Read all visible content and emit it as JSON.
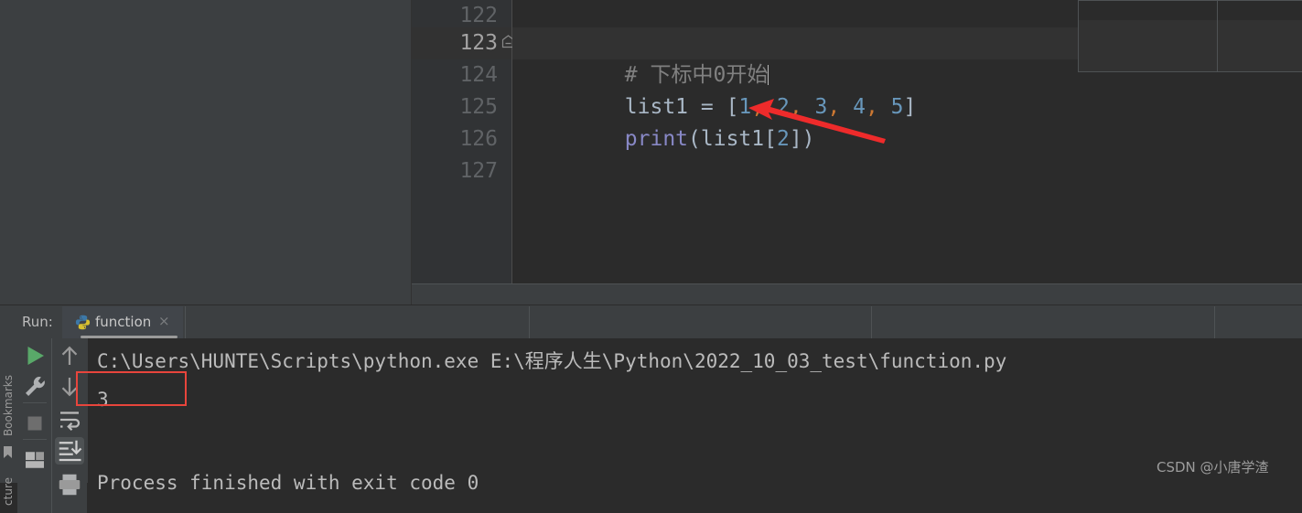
{
  "editor": {
    "lines": [
      {
        "number": "122",
        "current": false,
        "tokens": []
      },
      {
        "number": "123",
        "current": true,
        "tokens": [
          {
            "text": "# 下标中0开始",
            "type": "comment"
          }
        ]
      },
      {
        "number": "124",
        "current": false,
        "tokens": [
          {
            "text": "list1 ",
            "type": "ident"
          },
          {
            "text": "= ",
            "type": "punct"
          },
          {
            "text": "[",
            "type": "punct"
          },
          {
            "text": "1",
            "type": "num"
          },
          {
            "text": ", ",
            "type": "comma"
          },
          {
            "text": "2",
            "type": "num"
          },
          {
            "text": ", ",
            "type": "comma"
          },
          {
            "text": "3",
            "type": "num"
          },
          {
            "text": ", ",
            "type": "comma"
          },
          {
            "text": "4",
            "type": "num"
          },
          {
            "text": ", ",
            "type": "comma"
          },
          {
            "text": "5",
            "type": "num"
          },
          {
            "text": "]",
            "type": "punct"
          }
        ]
      },
      {
        "number": "125",
        "current": false,
        "tokens": [
          {
            "text": "print",
            "type": "func"
          },
          {
            "text": "(list1[",
            "type": "punct"
          },
          {
            "text": "2",
            "type": "num"
          },
          {
            "text": "])",
            "type": "punct"
          }
        ]
      },
      {
        "number": "126",
        "current": false,
        "tokens": []
      },
      {
        "number": "127",
        "current": false,
        "tokens": []
      }
    ],
    "line_texts": {
      "l122": "",
      "l123": "# 下标中0开始",
      "l124": "list1 = [1, 2, 3, 4, 5]",
      "l125": "print(list1[2])",
      "l126": "",
      "l127": ""
    },
    "line_numbers": {
      "n122": "122",
      "n123": "123",
      "n124": "124",
      "n125": "125",
      "n126": "126",
      "n127": "127"
    },
    "fold_marker": "code-fold-minus"
  },
  "run_panel": {
    "label": "Run:",
    "tab": {
      "icon": "python-icon",
      "title": "function",
      "close": "×"
    },
    "toolbar": {
      "rerun": "run-icon",
      "settings": "wrench-icon",
      "stop": "stop-icon",
      "layout": "layout-icon",
      "up": "arrow-up-icon",
      "down": "arrow-down-icon",
      "soft_wrap": "soft-wrap-icon",
      "scroll_to_end": "scroll-to-end-icon",
      "print": "print-icon"
    }
  },
  "sidebar": {
    "bookmarks_label": "Bookmarks",
    "structure_label": "cture",
    "bookmark_icon": "bookmark-icon"
  },
  "console": {
    "lines": [
      "C:\\Users\\HUNTE\\Scripts\\python.exe E:\\程序人生\\Python\\2022_10_03_test\\function.py",
      "3",
      "",
      "Process finished with exit code 0"
    ],
    "line1": "C:\\Users\\HUNTE\\Scripts\\python.exe E:\\程序人生\\Python\\2022_10_03_test\\function.py",
    "line2": "3",
    "line3": "Process finished with exit code 0"
  },
  "annotations": {
    "highlight_box_color": "#E8453C",
    "arrow_color": "#EE2B2B",
    "arrow_target": "print(list1[2])"
  },
  "watermark": {
    "text": "CSDN @小唐学渣"
  },
  "colors": {
    "editor_bg": "#2B2B2B",
    "panel_bg": "#3C3F41",
    "gutter_bg": "#313335",
    "current_line_bg": "#323232",
    "number_token": "#6897BB",
    "comment_token": "#808080",
    "function_token": "#8888C6",
    "comma_token": "#CC7832",
    "text_token": "#A9B7C6"
  }
}
